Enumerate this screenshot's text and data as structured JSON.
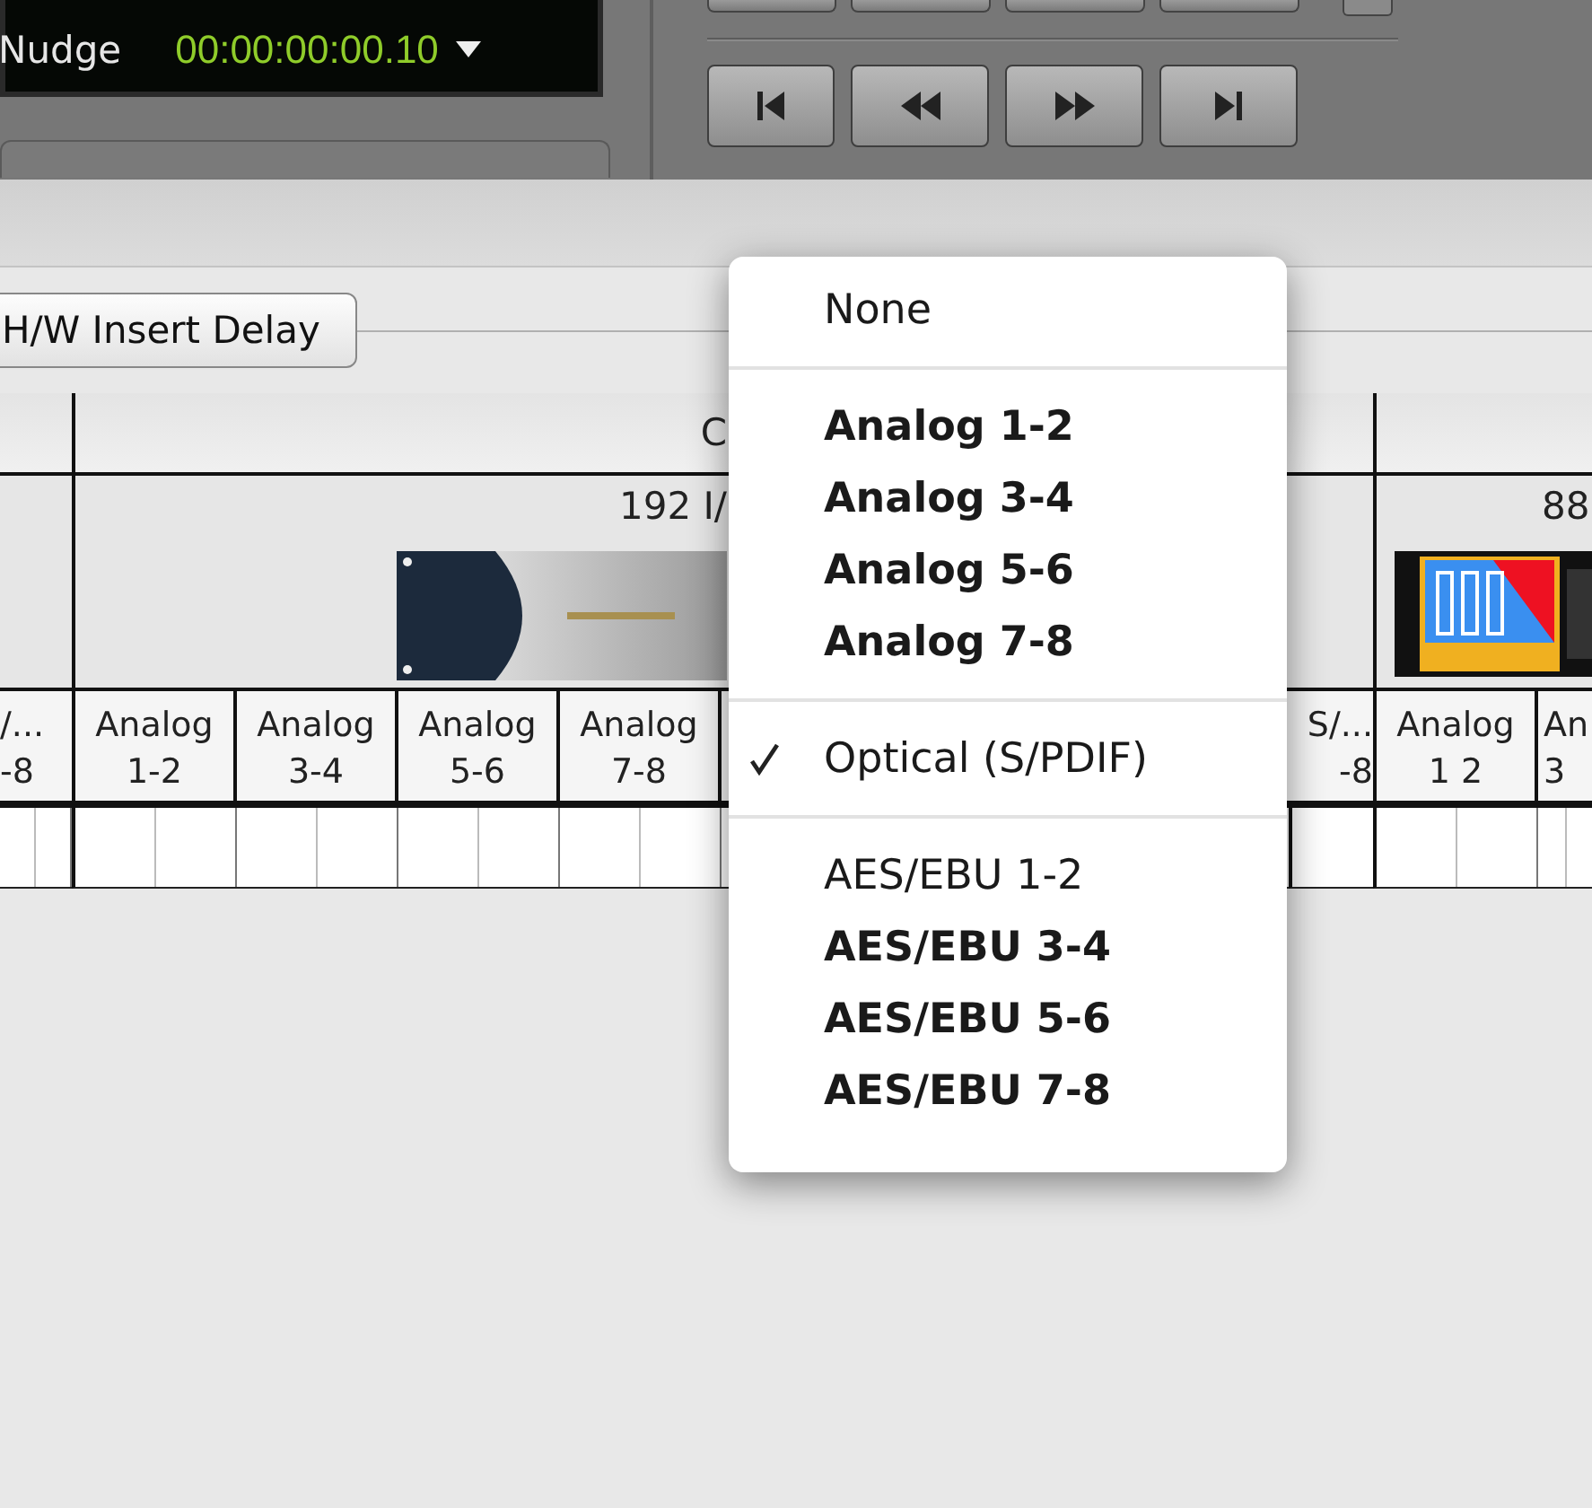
{
  "counter": {
    "label": "Nudge",
    "value": "00:00:00:00.10"
  },
  "transport_buttons": [
    {
      "kind": "start"
    },
    {
      "kind": "rewind"
    },
    {
      "kind": "forward"
    },
    {
      "kind": "end"
    }
  ],
  "insert_delay_button": "H/W Insert Delay",
  "table": {
    "groups": [
      {
        "columns": [
          {
            "lines": [
              "/...",
              "-8"
            ]
          }
        ]
      },
      {
        "header": "C",
        "device": {
          "name": "192 I/"
        },
        "columns": [
          {
            "lines": [
              "Analog",
              "1-2"
            ]
          },
          {
            "lines": [
              "Analog",
              "3-4"
            ]
          },
          {
            "lines": [
              "Analog",
              "5-6"
            ]
          },
          {
            "lines": [
              "Analog",
              "7-8"
            ]
          }
        ],
        "trailing_columns": [
          {
            "lines": [
              "S/...",
              "-8"
            ]
          }
        ]
      },
      {
        "device": {
          "name": "88"
        },
        "columns": [
          {
            "lines": [
              "Analog",
              "1 2"
            ]
          },
          {
            "lines": [
              "An",
              "3"
            ]
          }
        ]
      }
    ]
  },
  "popup_menu": {
    "sections": [
      [
        {
          "label": "None",
          "bold": false,
          "checked": false
        }
      ],
      [
        {
          "label": "Analog 1-2",
          "bold": true,
          "checked": false
        },
        {
          "label": "Analog 3-4",
          "bold": true,
          "checked": false
        },
        {
          "label": "Analog 5-6",
          "bold": true,
          "checked": false
        },
        {
          "label": "Analog 7-8",
          "bold": true,
          "checked": false
        }
      ],
      [
        {
          "label": "Optical (S/PDIF)",
          "bold": false,
          "checked": true
        }
      ],
      [
        {
          "label": "AES/EBU 1-2",
          "bold": false,
          "checked": false
        },
        {
          "label": "AES/EBU 3-4",
          "bold": true,
          "checked": false
        },
        {
          "label": "AES/EBU 5-6",
          "bold": true,
          "checked": false
        },
        {
          "label": "AES/EBU 7-8",
          "bold": true,
          "checked": false
        }
      ]
    ]
  }
}
